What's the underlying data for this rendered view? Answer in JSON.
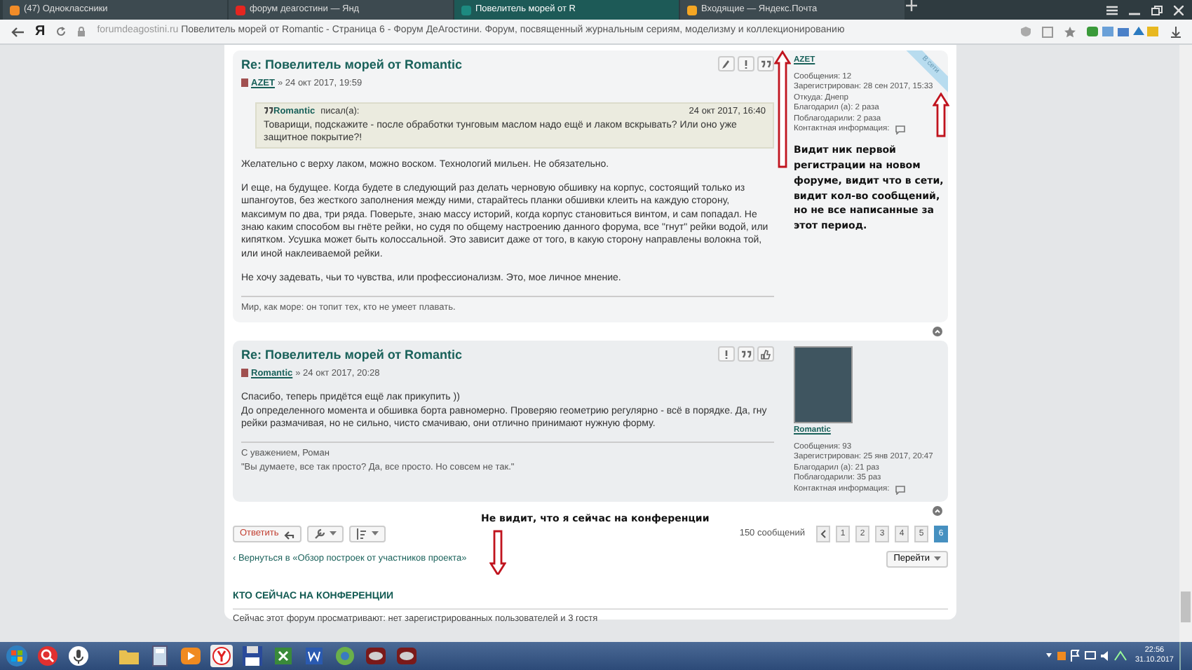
{
  "browser": {
    "tabs": [
      {
        "title": "(47) Одноклассники",
        "selected": false
      },
      {
        "title": "форум деагостини — Янд",
        "selected": false
      },
      {
        "title": "Повелитель морей от R",
        "selected": true
      },
      {
        "title": "Входящие — Яндекс.Почта",
        "selected": false
      }
    ],
    "logo": "Я",
    "url_host": "forumdeagostini.ru",
    "url_title": "Повелитель морей от Romantic - Страница 6 - Форум ДеАгостини. Форум, посвященный журнальным сериям, моделизму и коллекционированию"
  },
  "posts": [
    {
      "title": "Re: Повелитель морей от Romantic",
      "author": "AZET",
      "date": "» 24 окт 2017, 19:59",
      "buttons": [
        {
          "kind": "edit"
        },
        {
          "kind": "report"
        },
        {
          "kind": "quote"
        }
      ],
      "quote": {
        "author": "Romantic",
        "wrote": "писал(а):",
        "date": "24 окт 2017, 16:40",
        "text": "Товарищи, подскажите - после обработки тунговым маслом надо ещё и лаком вскрывать? Или оно уже защитное покрытие?!"
      },
      "paragraphs": [
        "Желательно с верху лаком, можно воском. Технологий мильен. Не обязательно.",
        "И еще, на будущее. Когда будете в следующий раз делать черновую обшивку на корпус, состоящий только из шпангоутов, без жесткого заполнения между ними, старайтесь планки обшивки клеить на каждую сторону, максимум по два, три ряда. Поверьте, знаю массу историй, когда корпус становиться винтом, и сам попадал. Не знаю каким способом вы гнёте рейки, но судя по общему настроению данного форума, все \"гнут\" рейки водой, или кипятком. Усушка может быть колоссальной. Это зависит даже от того, в какую сторону направлены волокна той, или иной наклеиваемой рейки.",
        "Не хочу задевать, чьи то чувства, или профессионализм. Это, мое личное мнение."
      ],
      "signature": [
        "Мир, как море: он топит тех, кто не умеет плавать."
      ],
      "profile": {
        "name": "AZET",
        "avatar": false,
        "online_badge": "В сети",
        "stats": [
          "Сообщения: 12",
          "Зарегистрирован: 28 сен 2017, 15:33",
          "Откуда: Днепр",
          "Благодарил (а): 2 раза",
          "Поблагодарили: 2 раза"
        ],
        "contact": "Контактная информация:"
      }
    },
    {
      "title": "Re: Повелитель морей от Romantic",
      "author": "Romantic",
      "date": "» 24 окт 2017, 20:28",
      "buttons": [
        {
          "kind": "report"
        },
        {
          "kind": "quote"
        },
        {
          "kind": "like"
        }
      ],
      "paragraphs": [
        "Спасибо, теперь придётся ещё лак прикупить ))\nДо определенного момента и обшивка борта равномерно. Проверяю геометрию регулярно - всё в порядке. Да, гну рейки размачивая, но не сильно, чисто смачиваю, они отлично принимают нужную форму."
      ],
      "signature": [
        "С уважением, Роман",
        "\"Вы думаете, все так просто? Да, все просто. Но совсем не так.\""
      ],
      "profile": {
        "name": "Romantic",
        "avatar": true,
        "stats": [
          "Сообщения: 93",
          "Зарегистрирован: 25 янв 2017, 20:47",
          "Благодарил (а): 21 раз",
          "Поблагодарили: 35 раз"
        ],
        "contact": "Контактная информация:"
      }
    }
  ],
  "actions": {
    "reply": "Ответить",
    "count": "150 сообщений",
    "pages": [
      {
        "label": "1",
        "selected": false
      },
      {
        "label": "2",
        "selected": false
      },
      {
        "label": "3",
        "selected": false
      },
      {
        "label": "4",
        "selected": false
      },
      {
        "label": "5",
        "selected": false
      },
      {
        "label": "6",
        "selected": true
      }
    ]
  },
  "back_link": "‹ Вернуться в «Обзор построек от участников проекта»",
  "jump": "Перейти",
  "online": {
    "heading": "КТО СЕЙЧАС НА КОНФЕРЕНЦИИ",
    "text": "Сейчас этот форум просматривают: нет зарегистрированных пользователей и 3 гостя"
  },
  "annotations": [
    {
      "text": "Видит ник первой регистрации на новом форуме, видит что в сети, видит кол-во сообщений, но не все написанные за этот период."
    },
    {
      "text": "Не видит, что я сейчас на конференции"
    }
  ],
  "taskbar": {
    "time": "22:56",
    "date": "31.10.2017"
  }
}
